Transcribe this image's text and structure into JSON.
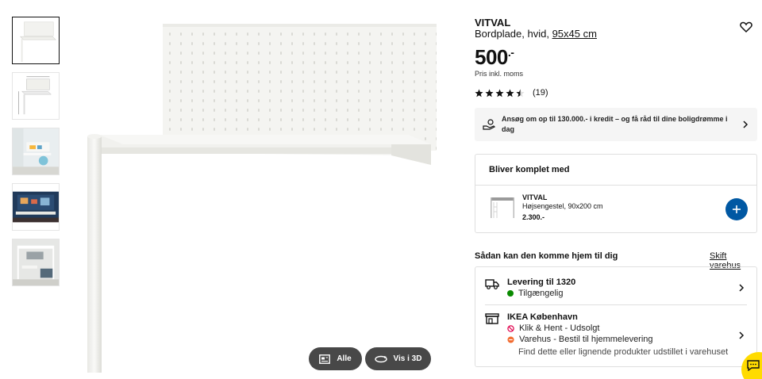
{
  "gallery": {
    "thumbnails": [
      "product-front",
      "product-dimensions",
      "room-kids-desk",
      "room-dark-bedroom",
      "room-loft-bed"
    ],
    "buttons": {
      "all_label": "Alle",
      "view3d_label": "Vis i 3D"
    }
  },
  "product": {
    "name": "VITVAL",
    "description": "Bordplade, hvid,",
    "size_link": "95x45 cm",
    "price_main": "500",
    "price_suffix": ".-",
    "price_note": "Pris inkl. moms",
    "rating_value": 4.5,
    "rating_count": "(19)"
  },
  "credit_banner": {
    "text": "Ansøg om op til 130.000.- i kredit – og få råd til dine boligdrømme i dag",
    "icon": "hand-coins-icon"
  },
  "complete_with": {
    "title": "Bliver komplet med",
    "item": {
      "name": "VITVAL",
      "description": "Højsengestel, 90x200 cm",
      "price": "2.300.-"
    }
  },
  "delivery": {
    "heading": "Sådan kan den komme hjem til dig",
    "change_store": "Skift varehus",
    "home": {
      "title": "Levering til 1320",
      "status": "Tilgængelig",
      "status_color": "#0a8a00"
    },
    "store": {
      "title": "IKEA København",
      "click_collect": "Klik & Hent - Udsolgt",
      "click_collect_color": "#e00751",
      "warehouse": "Varehus - Bestil til hjemmelevering",
      "warehouse_color": "#f26a2e",
      "note": "Find dette eller lignende produkter udstillet i varehuset"
    }
  },
  "colors": {
    "accent_blue": "#0058a3",
    "chat_yellow": "#ffdb00",
    "button_dark": "#484848"
  }
}
